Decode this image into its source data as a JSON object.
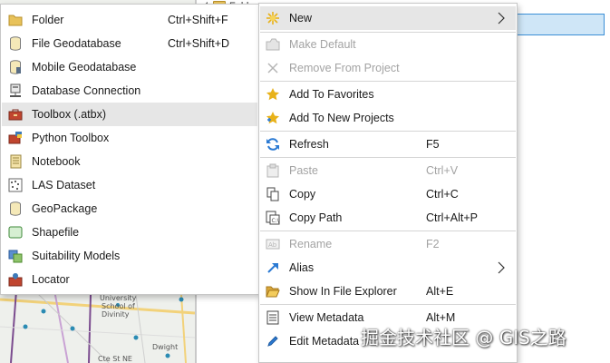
{
  "background": {
    "tree_folder_label": "Folders",
    "map_labels": [
      "University",
      "School of",
      "Divinity",
      "Dwight",
      "Cte St NE"
    ]
  },
  "submenu": {
    "items": [
      {
        "icon": "folder-icon",
        "label": "Folder",
        "shortcut": "Ctrl+Shift+F",
        "highlighted": false
      },
      {
        "icon": "file-geodatabase-icon",
        "label": "File Geodatabase",
        "shortcut": "Ctrl+Shift+D",
        "highlighted": false
      },
      {
        "icon": "mobile-geodatabase-icon",
        "label": "Mobile Geodatabase",
        "shortcut": "",
        "highlighted": false
      },
      {
        "icon": "database-connection-icon",
        "label": "Database Connection",
        "shortcut": "",
        "highlighted": false
      },
      {
        "icon": "toolbox-icon",
        "label": "Toolbox (.atbx)",
        "shortcut": "",
        "highlighted": true
      },
      {
        "icon": "python-toolbox-icon",
        "label": "Python Toolbox",
        "shortcut": "",
        "highlighted": false
      },
      {
        "icon": "notebook-icon",
        "label": "Notebook",
        "shortcut": "",
        "highlighted": false
      },
      {
        "icon": "las-dataset-icon",
        "label": "LAS Dataset",
        "shortcut": "",
        "highlighted": false
      },
      {
        "icon": "geopackage-icon",
        "label": "GeoPackage",
        "shortcut": "",
        "highlighted": false
      },
      {
        "icon": "shapefile-icon",
        "label": "Shapefile",
        "shortcut": "",
        "highlighted": false
      },
      {
        "icon": "suitability-models-icon",
        "label": "Suitability Models",
        "shortcut": "",
        "highlighted": false
      },
      {
        "icon": "locator-icon",
        "label": "Locator",
        "shortcut": "",
        "highlighted": false
      }
    ]
  },
  "context_menu": {
    "items": [
      {
        "icon": "new-icon",
        "label": "New",
        "shortcut": "",
        "disabled": false,
        "submenu": true,
        "highlighted": true
      },
      {
        "icon": "make-default-icon",
        "label": "Make Default",
        "shortcut": "",
        "disabled": true
      },
      {
        "icon": "remove-icon",
        "label": "Remove From Project",
        "shortcut": "",
        "disabled": true
      },
      {
        "icon": "favorites-star-icon",
        "label": "Add To Favorites",
        "shortcut": "",
        "disabled": false
      },
      {
        "icon": "new-projects-star-icon",
        "label": "Add To New Projects",
        "shortcut": "",
        "disabled": false
      },
      {
        "icon": "refresh-icon",
        "label": "Refresh",
        "shortcut": "F5",
        "disabled": false
      },
      {
        "icon": "paste-icon",
        "label": "Paste",
        "shortcut": "Ctrl+V",
        "disabled": true
      },
      {
        "icon": "copy-icon",
        "label": "Copy",
        "shortcut": "Ctrl+C",
        "disabled": false
      },
      {
        "icon": "copy-path-icon",
        "label": "Copy Path",
        "shortcut": "Ctrl+Alt+P",
        "disabled": false
      },
      {
        "icon": "rename-icon",
        "label": "Rename",
        "shortcut": "F2",
        "disabled": true
      },
      {
        "icon": "alias-icon",
        "label": "Alias",
        "shortcut": "",
        "disabled": false,
        "submenu": true
      },
      {
        "icon": "show-in-explorer-icon",
        "label": "Show In File Explorer",
        "shortcut": "Alt+E",
        "disabled": false
      },
      {
        "icon": "view-metadata-icon",
        "label": "View Metadata",
        "shortcut": "Alt+M",
        "disabled": false
      },
      {
        "icon": "edit-metadata-icon",
        "label": "Edit Metadata",
        "shortcut": "",
        "disabled": false
      }
    ]
  },
  "watermark": "掘金技术社区 @ GIS之路",
  "colors": {
    "highlight": "#e6e6e6",
    "disabled_text": "#a3a3a3",
    "selection_fill": "#cfe6f7",
    "selection_border": "#3b8fd6",
    "star": "#e8b21a",
    "folder": "#e8c25a",
    "refresh_blue": "#2b7ad3"
  }
}
